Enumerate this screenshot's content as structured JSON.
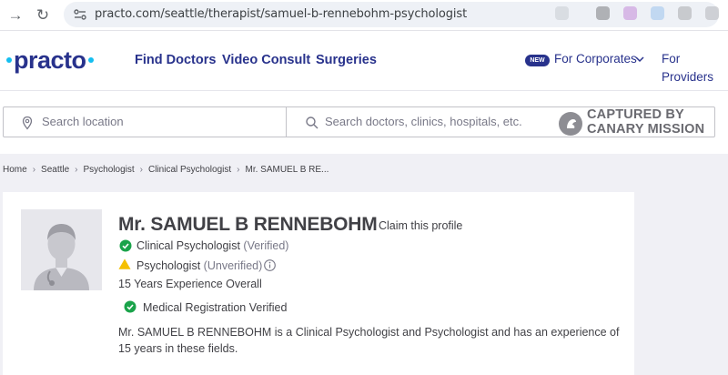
{
  "browser": {
    "url": "practo.com/seattle/therapist/samuel-b-rennebohm-psychologist"
  },
  "header": {
    "logo": "practo",
    "nav": [
      "Find Doctors",
      "Video Consult",
      "Surgeries"
    ],
    "new_badge": "NEW",
    "corporates": "For Corporates",
    "providers": "For Providers"
  },
  "search": {
    "location_placeholder": "Search location",
    "doctor_placeholder": "Search doctors, clinics, hospitals, etc."
  },
  "watermark": {
    "line1": "CAPTURED BY",
    "line2": "CANARY MISSION"
  },
  "breadcrumb": [
    "Home",
    "Seattle",
    "Psychologist",
    "Clinical Psychologist",
    "Mr. SAMUEL B RE..."
  ],
  "profile": {
    "name": "Mr. SAMUEL B RENNEBOHM",
    "claim": "Claim this profile",
    "specialty1": "Clinical Psychologist",
    "specialty1_status": "(Verified)",
    "specialty2": "Psychologist",
    "specialty2_status": "(Unverified)",
    "experience": "15 Years Experience Overall",
    "registration": "Medical Registration Verified",
    "description": "Mr. SAMUEL B RENNEBOHM is a Clinical Psychologist and Psychologist and has an experience of 15 years in these fields."
  },
  "colors": {
    "brand_navy": "#28328c",
    "brand_cyan": "#14bef0",
    "verified_green": "#1aa34a",
    "warning_yellow": "#f5c000"
  }
}
